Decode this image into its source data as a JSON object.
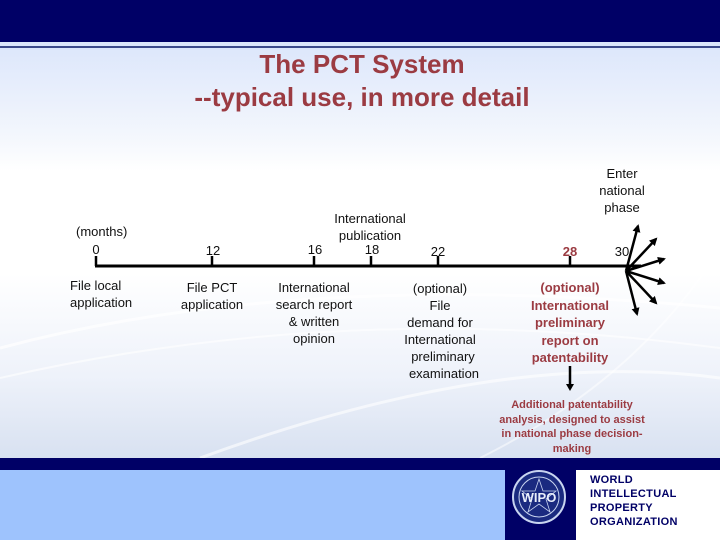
{
  "title": {
    "line1": "The PCT System",
    "line2": "--typical use, in more detail"
  },
  "colors": {
    "header_bar": "#000066",
    "title_red": "#9b3b42",
    "footer_light": "#9ec3fd"
  },
  "timeline": {
    "unit_label": "(months)",
    "ticks": [
      {
        "month": "0",
        "label_above": "",
        "label_below": "File local\napplication"
      },
      {
        "month": "12",
        "label_above": "",
        "label_below": "File PCT\napplication"
      },
      {
        "month": "16",
        "label_above": "",
        "label_below": "International\nsearch report\n& written\nopinion"
      },
      {
        "month": "18",
        "label_above": "International\npublication",
        "label_below": ""
      },
      {
        "month": "22",
        "label_above": "",
        "label_below": "(optional)\nFile\ndemand for\nInternational\npreliminary\nexamination"
      },
      {
        "month": "28",
        "label_above": "",
        "label_below": "(optional)\nInternational\npreliminary\nreport on\npatentability"
      },
      {
        "month": "30",
        "label_above": "Enter\nnational\nphase",
        "label_below": ""
      }
    ],
    "labels": {
      "months": "(months)",
      "m0": "0",
      "m12": "12",
      "m16": "16",
      "m18": "18",
      "m22": "22",
      "m28": "28",
      "m30": "30",
      "file_local_1": "File local",
      "file_local_2": "application",
      "file_pct_1": "File PCT",
      "file_pct_2": "application",
      "isr_1": "International",
      "isr_2": "search report",
      "isr_3": "& written",
      "isr_4": "opinion",
      "pub_1": "International",
      "pub_2": "publication",
      "demand_1": "(optional)",
      "demand_2": "File",
      "demand_3": "demand for",
      "demand_4": "International",
      "demand_5": "preliminary",
      "demand_6": "examination",
      "iprp_1": "(optional)",
      "iprp_2": "International",
      "iprp_3": "preliminary",
      "iprp_4": "report on",
      "iprp_5": "patentability",
      "enter_1": "Enter",
      "enter_2": "national",
      "enter_3": "phase",
      "extra_1": "Additional patentability",
      "extra_2": "analysis, designed to assist",
      "extra_3": "in national phase decision-",
      "extra_4": "making"
    }
  },
  "footer": {
    "org_line1": "World",
    "org_line2": "Intellectual",
    "org_line3": "Property",
    "org_line4": "Organization",
    "seal_text": "WIPO"
  }
}
